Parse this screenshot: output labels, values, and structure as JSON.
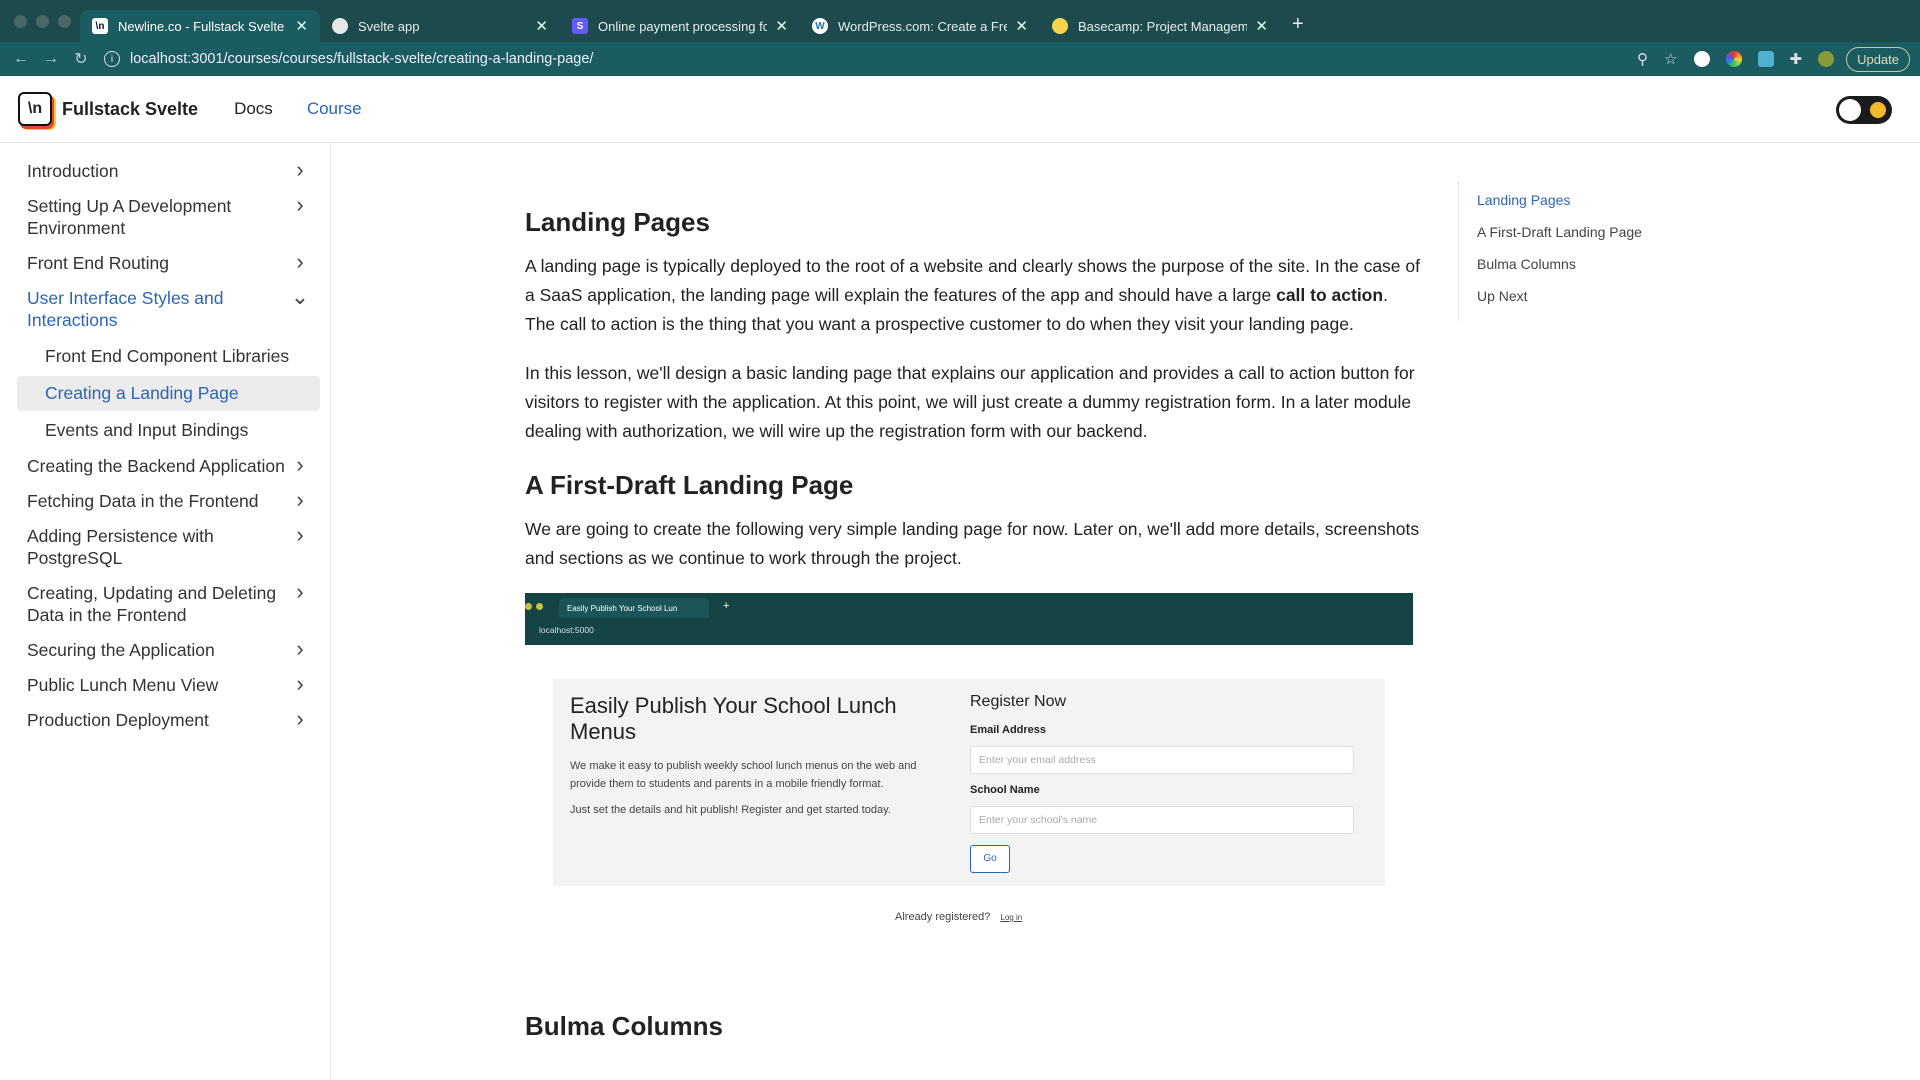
{
  "browser": {
    "tabs": [
      {
        "title": "Newline.co - Fullstack Svelte C",
        "active": true,
        "icon": "newline-icon"
      },
      {
        "title": "Svelte app",
        "active": false,
        "icon": "svelte-icon"
      },
      {
        "title": "Online payment processing for",
        "active": false,
        "icon": "stripe-icon"
      },
      {
        "title": "WordPress.com: Create a Free",
        "active": false,
        "icon": "wordpress-icon"
      },
      {
        "title": "Basecamp: Project Managemen",
        "active": false,
        "icon": "basecamp-icon"
      }
    ],
    "url": "localhost:3001/courses/courses/fullstack-svelte/creating-a-landing-page/",
    "update_label": "Update"
  },
  "header": {
    "logo_text": "\\n",
    "brand": "Fullstack Svelte",
    "nav": [
      "Docs",
      "Course"
    ]
  },
  "sidebar": {
    "items": [
      {
        "label": "Introduction"
      },
      {
        "label": "Setting Up A Development Environment"
      },
      {
        "label": "Front End Routing"
      },
      {
        "label": "User Interface Styles and Interactions",
        "open": true
      },
      {
        "label": "Creating the Backend Application"
      },
      {
        "label": "Fetching Data in the Frontend"
      },
      {
        "label": "Adding Persistence with PostgreSQL"
      },
      {
        "label": "Creating, Updating and Deleting Data in the Frontend"
      },
      {
        "label": "Securing the Application"
      },
      {
        "label": "Public Lunch Menu View"
      },
      {
        "label": "Production Deployment"
      }
    ],
    "subitems": [
      "Front End Component Libraries",
      "Creating a Landing Page",
      "Events and Input Bindings"
    ]
  },
  "article": {
    "h1": "Landing Pages",
    "p1_before": "A landing page is typically deployed to the root of a website and clearly shows the purpose of the site. In the case of a SaaS application, the landing page will explain the features of the app and should have a large ",
    "p1_bold": "call to action",
    "p1_after": ". The call to action is the thing that you want a prospective customer to do when they visit your landing page.",
    "p2": "In this lesson, we'll design a basic landing page that explains our application and provides a call to action button for visitors to register with the application. At this point, we will just create a dummy registration form. In a later module dealing with authorization, we will wire up the registration form with our backend.",
    "h2": "A First-Draft Landing Page",
    "p3": "We are going to create the following very simple landing page for now. Later on, we'll add more details, screenshots and sections as we continue to work through the project.",
    "h3": "Bulma Columns"
  },
  "screenshot": {
    "tab_title": "Easily Publish Your School Lun",
    "url": "localhost:5000",
    "title": "Easily Publish Your School Lunch Menus",
    "desc": "We make it easy to publish weekly school lunch menus on the web and provide them to students and parents in a mobile friendly format.",
    "desc2": "Just set the details and hit publish! Register and get started today.",
    "register": "Register Now",
    "email_label": "Email Address",
    "email_placeholder": "Enter your email address",
    "school_label": "School Name",
    "school_placeholder": "Enter your school's name",
    "go": "Go",
    "already": "Already registered?",
    "login": "Log in"
  },
  "toc": [
    "Landing Pages",
    "A First-Draft Landing Page",
    "Bulma Columns",
    "Up Next"
  ]
}
